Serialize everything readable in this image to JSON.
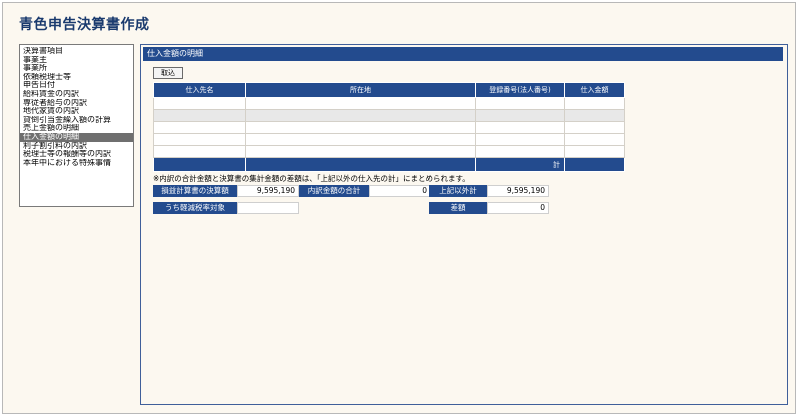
{
  "app": {
    "title": "青色申告決算書作成"
  },
  "sidebar": {
    "items": [
      {
        "label": "決算書項目"
      },
      {
        "label": "事業主"
      },
      {
        "label": "事業所"
      },
      {
        "label": "依頼税理士等"
      },
      {
        "label": "申告日付"
      },
      {
        "label": "給料賃金の内訳"
      },
      {
        "label": "専従者給与の内訳"
      },
      {
        "label": "地代家賃の内訳"
      },
      {
        "label": "貸倒引当金繰入額の計算"
      },
      {
        "label": "売上金額の明細"
      },
      {
        "label": "仕入金額の明細",
        "selected": true
      },
      {
        "label": "利子割引料の内訳"
      },
      {
        "label": "税理士等の報酬等の内訳"
      },
      {
        "label": "本年中における特殊事情"
      }
    ]
  },
  "main": {
    "section_title": "仕入金額の明細",
    "import_button": "取込",
    "table": {
      "columns": [
        "仕入先名",
        "所在地",
        "登録番号(法人番号)",
        "仕入金額"
      ],
      "rows": [
        [
          "",
          "",
          "",
          ""
        ],
        [
          "",
          "",
          "",
          ""
        ],
        [
          "",
          "",
          "",
          ""
        ],
        [
          "",
          "",
          "",
          ""
        ],
        [
          "",
          "",
          "",
          ""
        ]
      ],
      "total_label": "計"
    },
    "note": "※内訳の合計金額と決算書の集計金額の差額は、「上記以外の仕入先の計」にまとめられます。",
    "summary": {
      "settlement_label": "損益計算書の決算額",
      "settlement_value": "9,595,190",
      "breakdown_label": "内訳金額の合計",
      "breakdown_value": "0",
      "other_label": "上記以外計",
      "other_value": "9,595,190",
      "reduced_tax_label": "うち軽減税率対象",
      "reduced_tax_value": "",
      "difference_label": "差額",
      "difference_value": "0"
    }
  },
  "colors": {
    "header_blue": "#234b8e",
    "title_blue": "#1a3a6e",
    "panel_bg": "#fcf8f0",
    "selected_gray": "#6f6f6f"
  }
}
